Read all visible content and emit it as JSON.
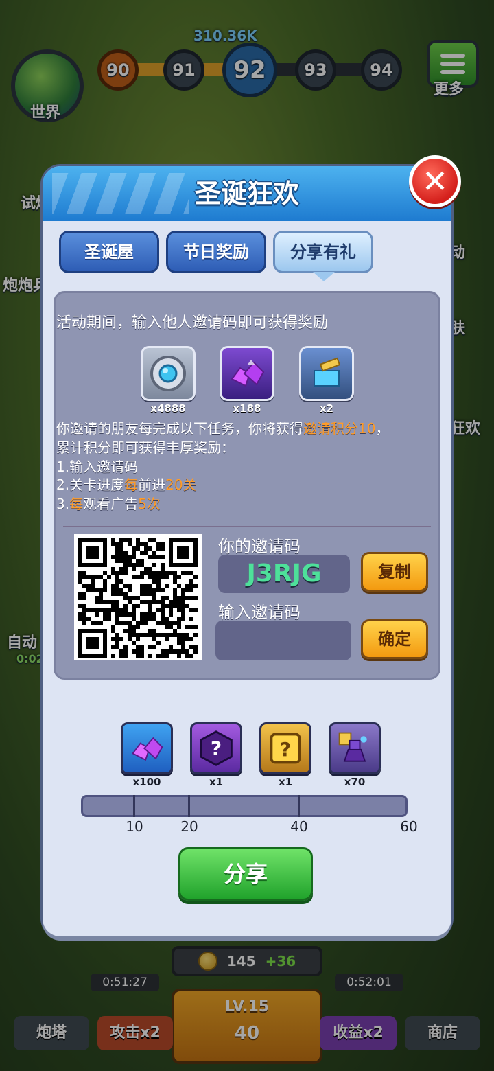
{
  "hud": {
    "world_label": "世界",
    "more_label": "更多",
    "left_labels": [
      "试炼",
      "炮炮兵",
      "自动"
    ],
    "auto_timer": "0:02",
    "right_labels": [
      "动",
      "肤",
      "狂欢"
    ],
    "levels": [
      "90",
      "91",
      "92",
      "93",
      "94"
    ],
    "current_level": "92",
    "score_text": "310.36K"
  },
  "modal": {
    "title": "圣诞狂欢",
    "tabs": [
      {
        "label": "圣诞屋"
      },
      {
        "label": "节日奖励"
      },
      {
        "label": "分享有礼"
      }
    ],
    "intro": "活动期间，输入他人邀请码即可获得奖励",
    "invite_rewards": [
      {
        "icon": "gear-core-icon",
        "count": "x4888",
        "color": "#9ea8b8"
      },
      {
        "icon": "purple-gem-icon",
        "count": "x188",
        "color": "#6a3fb0"
      },
      {
        "icon": "blue-crystal-hammer-icon",
        "count": "x2",
        "color": "#4e6fa8"
      }
    ],
    "desc": {
      "line1_a": "你邀请的朋友每完成以下任务，你将获得",
      "line1_b": "邀请积分10",
      "line1_c": "，",
      "line2": "累计积分即可获得丰厚奖励：",
      "task1": "1.输入邀请码",
      "task2_a": "2.关卡进度",
      "task2_b": "每",
      "task2_c": "前进",
      "task2_d": "20关",
      "task3_a": "3.",
      "task3_b": "每",
      "task3_c": "观看广告",
      "task3_d": "5次"
    },
    "my_code_label": "你的邀请码",
    "my_code": "J3RJG",
    "copy_label": "复制",
    "enter_code_label": "输入邀请码",
    "enter_code_value": "",
    "confirm_label": "确定",
    "milestone_rewards": [
      {
        "icon": "purple-gem-icon",
        "count": "x100",
        "bg": "#2f7fd6"
      },
      {
        "icon": "mystery-hexagon-icon",
        "count": "x1",
        "bg": "#7a3cc0"
      },
      {
        "icon": "mystery-box-icon",
        "count": "x1",
        "bg": "#d49a20"
      },
      {
        "icon": "tower-upgrade-icon",
        "count": "x70",
        "bg": "#6a5aa8"
      }
    ],
    "milestones": [
      "10",
      "20",
      "40",
      "60"
    ],
    "progress_value": 0,
    "share_label": "分享"
  },
  "bottom": {
    "coins": "145",
    "coins_plus": "+36",
    "timer_left": "0:51:27",
    "timer_right": "0:52:01",
    "level": "LV.15",
    "upgrade_cost": "40",
    "turret_label": "炮塔",
    "attack_label": "攻击x2",
    "income_label": "收益x2",
    "shop_label": "商店"
  }
}
